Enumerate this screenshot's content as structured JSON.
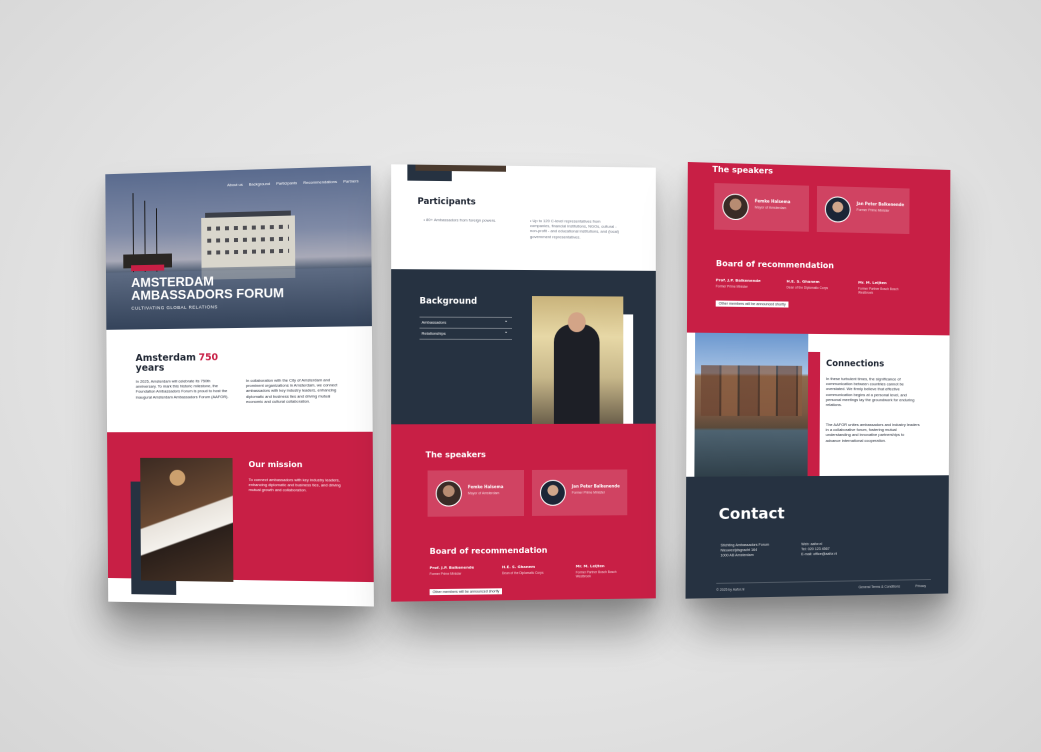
{
  "page1": {
    "nav": [
      "About us",
      "Background",
      "Participants",
      "Recommendations",
      "Partners"
    ],
    "hero": {
      "tag": "",
      "title_line1": "AMSTERDAM",
      "title_line2": "AMBASSADORS FORUM",
      "subtitle": "CULTIVATING GLOBAL RELATIONS"
    },
    "intro": {
      "title_prefix": "Amsterdam",
      "title_number": "750",
      "title_suffix": "years",
      "col1": "In 2025, Amsterdam will celebrate its 750th anniversary. To mark this historic milestone, the Foundation Ambassadors Forum is proud to host the inaugural Amsterdam Ambassadors Forum (AAFOR).",
      "col2": "In collaboration with the City of Amsterdam and prominent organizations in Amsterdam, we connect ambassadors with key industry leaders, enhancing diplomatic and business ties and driving mutual economic and cultural collaboration."
    },
    "mission": {
      "title": "Our mission",
      "text": "To connect ambassadors with key industry leaders, enhancing diplomatic and business ties, and driving mutual growth and collaboration."
    }
  },
  "page2": {
    "participants": {
      "title": "Participants",
      "left": "• 80+ Ambassadors from foreign powers.",
      "right": "• Up to 120 C-level representatives from companies, financial institutions, NGOs, cultural - non-profit - and educational institutions, and (local) government representatives."
    },
    "background": {
      "title": "Background",
      "items": [
        "Ambassadors",
        "Relationships"
      ]
    },
    "speakers": {
      "title": "The speakers",
      "list": [
        {
          "name": "Femke Halsema",
          "role": "Mayor of Amsterdam"
        },
        {
          "name": "Jan Peter Balkenende",
          "role": "Former Prime Minister"
        }
      ]
    },
    "board": {
      "title": "Board of recommendation",
      "members": [
        {
          "name": "Prof. J.P. Balkenende",
          "role": "Former Prime Minister"
        },
        {
          "name": "H.E. S. Ghanem",
          "role": "Dean of the Diplomatic Corps"
        },
        {
          "name": "Mr. M. Leijten",
          "role": "Former Partner Bosch Bosch Westbroek"
        }
      ],
      "note": "Other members will be announced shortly"
    }
  },
  "page3": {
    "speakers": {
      "title": "The speakers",
      "list": [
        {
          "name": "Femke Halsema",
          "role": "Mayor of Amsterdam"
        },
        {
          "name": "Jan Peter Balkenende",
          "role": "Former Prime Minister"
        }
      ]
    },
    "board": {
      "title": "Board of recommendation",
      "members": [
        {
          "name": "Prof. J.P. Balkenende",
          "role": "Former Prime Minister"
        },
        {
          "name": "H.E. S. Ghanem",
          "role": "Dean of the Diplomatic Corps"
        },
        {
          "name": "Mr. M. Leijten",
          "role": "Former Partner Bosch Bosch Westbroek"
        }
      ],
      "note": "Other members will be announced shortly"
    },
    "connections": {
      "title": "Connections",
      "p1": "In these turbulent times, the significance of communication between countries cannot be overstated. We firmly believe that effective communication begins at a personal level, and personal meetings lay the groundwork for enduring relations.",
      "p2": "The AAFOR unites ambassadors and industry leaders in a collaborative forum, fostering mutual understanding and innovative partnerships to advance international cooperation."
    },
    "contact": {
      "title": "Contact",
      "address": [
        "Stichting Ambassadors Forum",
        "Nieuwezijdsgracht 164",
        "1000 AB Amsterdam"
      ],
      "web": [
        "Web: aafor.nl",
        "Tel: 020 123 4567",
        "E-mail: office@aafor.nl"
      ]
    },
    "footer": {
      "copyright": "© 2025 by Aafor.nl",
      "terms": "General Terms & Conditions",
      "privacy": "Privacy"
    }
  },
  "colors": {
    "accent": "#c81f45",
    "navy": "#263241",
    "background": "#e6e6e6"
  }
}
